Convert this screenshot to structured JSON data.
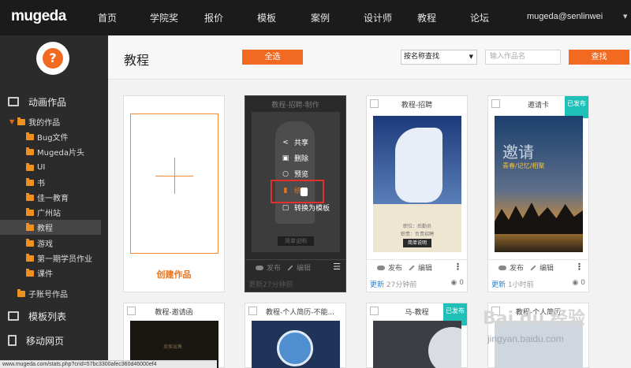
{
  "topnav": {
    "logo": "mugeda",
    "items": [
      "首页",
      "学院奖",
      "报价",
      "模板",
      "案例",
      "设计师",
      "教程",
      "论坛"
    ],
    "user": "mugeda@senlinwei"
  },
  "sidebar": {
    "avatar_glyph": "?",
    "section_animations": "动画作品",
    "my_works": "我的作品",
    "folders": [
      "Bug文件",
      "Mugeda片头",
      "UI",
      "书",
      "佳一教育",
      "广州站",
      "教程",
      "游戏",
      "第一期学员作业",
      "课件"
    ],
    "active_folder": "教程",
    "sub_account": "子账号作品",
    "template_list": "模板列表",
    "mobile_web": "移动网页"
  },
  "header": {
    "title": "教程",
    "select_all": "全选",
    "search_mode": "按名称查找",
    "search_placeholder": "输入作品名",
    "search_button": "查找"
  },
  "cards": {
    "create_label": "创建作品",
    "c1": {
      "title": "教程-招聘-制作",
      "menu": [
        "共享",
        "删除",
        "预览",
        "转换为模板"
      ],
      "menu_partial": "统计",
      "inner_button": "简单说明",
      "publish": "发布",
      "edit": "编辑",
      "meta": "更新27分钟前"
    },
    "c2": {
      "title": "教程-招聘",
      "caption": "职位：后勤员",
      "caption2": "职责：负责招聘",
      "button": "简单说明",
      "publish": "发布",
      "edit": "编辑",
      "updated": "更新",
      "time": "27分钟前",
      "views": "0"
    },
    "c3": {
      "title": "邀请卡",
      "badge": "已发布",
      "big": "邀请",
      "tagline": "青春/记忆/相聚",
      "publish": "发布",
      "edit": "编辑",
      "updated": "更新",
      "time": "1小时前",
      "views": "0"
    },
    "row2": [
      "教程-邀请函",
      "教程-个人简历-不能...",
      "马-教程",
      "教程-个人简历"
    ],
    "row2_badge": "已发布",
    "row2_thumb_text": "卖家出售"
  },
  "status_url": "www.mugeda.com/stats.php?crid=57bc3300afec360d46000ef4",
  "watermark": {
    "brand": "Bai du 经验",
    "site": "jingyan.baidu.com"
  }
}
